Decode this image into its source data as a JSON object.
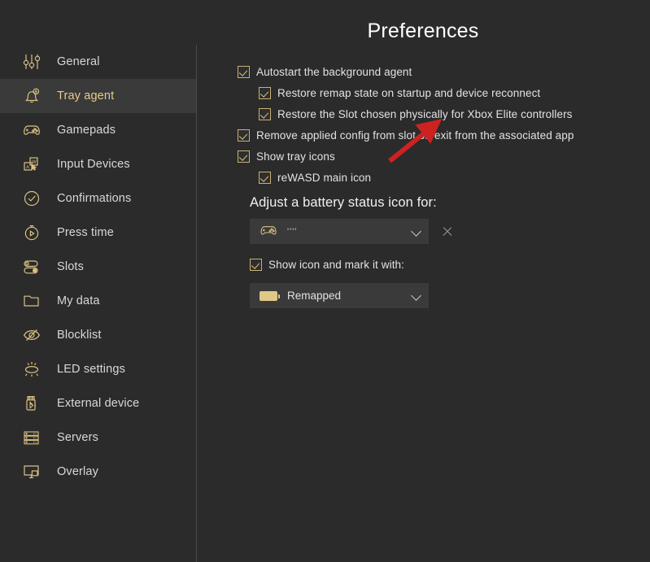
{
  "window": {
    "title": "Preferences",
    "background_color": "#2b2b2b",
    "accent_color": "#d9c183",
    "selected_row_color": "#3a3a3a"
  },
  "sidebar": {
    "items": [
      {
        "label": "General",
        "icon": "sliders-icon",
        "selected": false
      },
      {
        "label": "Tray agent",
        "icon": "bell-bolt-icon",
        "selected": true
      },
      {
        "label": "Gamepads",
        "icon": "gamepad-icon",
        "selected": false
      },
      {
        "label": "Input Devices",
        "icon": "keyboard-cursor-icon",
        "selected": false
      },
      {
        "label": "Confirmations",
        "icon": "check-circle-icon",
        "selected": false
      },
      {
        "label": "Press time",
        "icon": "stopwatch-play-icon",
        "selected": false
      },
      {
        "label": "Slots",
        "icon": "toggles-icon",
        "selected": false
      },
      {
        "label": "My data",
        "icon": "folder-icon",
        "selected": false
      },
      {
        "label": "Blocklist",
        "icon": "eye-slash-icon",
        "selected": false
      },
      {
        "label": "LED settings",
        "icon": "led-light-icon",
        "selected": false
      },
      {
        "label": "External device",
        "icon": "usb-bluetooth-icon",
        "selected": false
      },
      {
        "label": "Servers",
        "icon": "server-rack-icon",
        "selected": false
      },
      {
        "label": "Overlay",
        "icon": "monitor-overlay-icon",
        "selected": false
      }
    ]
  },
  "main": {
    "options": [
      {
        "label": "Autostart the background agent",
        "checked": true,
        "indent": false
      },
      {
        "label": "Restore remap state on startup and device reconnect",
        "checked": true,
        "indent": true
      },
      {
        "label": "Restore the Slot chosen physically for Xbox Elite controllers",
        "checked": true,
        "indent": true
      },
      {
        "label": "Remove applied config from slot on exit from the associated app",
        "checked": true,
        "indent": false
      },
      {
        "label": "Show tray icons",
        "checked": true,
        "indent": false
      },
      {
        "label": "reWASD main icon",
        "checked": true,
        "indent": true
      }
    ],
    "battery_section": {
      "heading": "Adjust a battery status icon for:",
      "device_dropdown": {
        "value": "''''",
        "icon": "gamepad-icon",
        "chevron": "chevron-down-icon"
      },
      "clear_button": {
        "icon": "close-icon"
      },
      "mark_checkbox": {
        "label": "Show icon and mark it with:",
        "checked": true
      },
      "mark_dropdown": {
        "value": "Remapped",
        "icon": "battery-icon",
        "chevron": "chevron-down-icon"
      }
    }
  },
  "annotation": {
    "arrow_color": "#cc2222",
    "points_at": "Remove applied config from slot on exit from the associated app"
  }
}
